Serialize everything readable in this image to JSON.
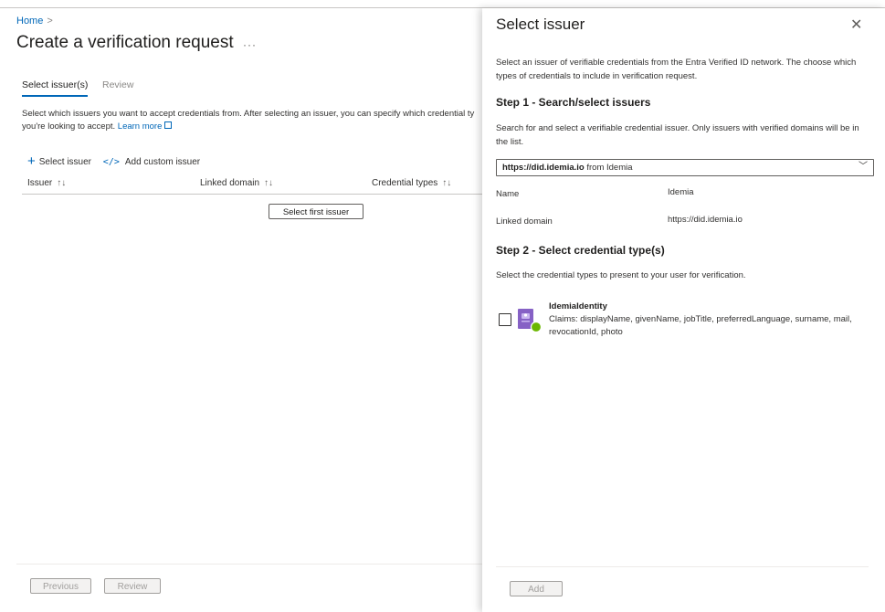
{
  "breadcrumb": {
    "home": "Home",
    "separator": ">"
  },
  "page": {
    "title": "Create a verification request",
    "more_label": "···",
    "tabs": [
      {
        "label": "Select issuer(s)",
        "active": true
      },
      {
        "label": "Review",
        "active": false
      }
    ],
    "description_line1": "Select which issuers you want to accept credentials from. After selecting an issuer, you can specify which credential ty",
    "description_line2": "you're looking to accept.",
    "learn_more": "Learn more",
    "commands": {
      "select_issuer": "Select issuer",
      "add_custom_issuer": "Add custom issuer"
    },
    "table": {
      "columns": [
        "Issuer",
        "Linked domain",
        "Credential types"
      ],
      "sort_glyph": "↑↓",
      "empty_button": "Select first issuer"
    },
    "footer": {
      "previous": "Previous",
      "review": "Review"
    }
  },
  "panel": {
    "title": "Select issuer",
    "close_glyph": "✕",
    "intro": "Select an issuer of verifiable credentials from the Entra Verified ID network. The choose which types of credentials to include in verification request.",
    "step1": {
      "heading": "Step 1 - Search/select issuers",
      "description": "Search for and select a verifiable credential issuer. Only issuers with verified domains will be in the list.",
      "selected_domain": "https://did.idemia.io",
      "selected_from": "from Idemia",
      "chevron": "﹀"
    },
    "properties": {
      "name_label": "Name",
      "name_value": "Idemia",
      "domain_label": "Linked domain",
      "domain_value": "https://did.idemia.io"
    },
    "step2": {
      "heading": "Step 2 - Select credential type(s)",
      "description": "Select the credential types to present to your user for verification.",
      "credential": {
        "title": "IdemiaIdentity",
        "claims": "Claims: displayName, givenName, jobTitle, preferredLanguage, surname, mail, revocationId, photo"
      }
    },
    "footer": {
      "add": "Add"
    }
  },
  "colors": {
    "accent": "#0067b8",
    "logo_purple": "#8661c5",
    "logo_green": "#6bb700"
  },
  "icons": [
    "chevron-right-icon",
    "more-icon",
    "external-link-icon",
    "plus-icon",
    "code-icon",
    "sort-icon",
    "close-icon",
    "chevron-down-icon",
    "credential-logo-icon"
  ]
}
